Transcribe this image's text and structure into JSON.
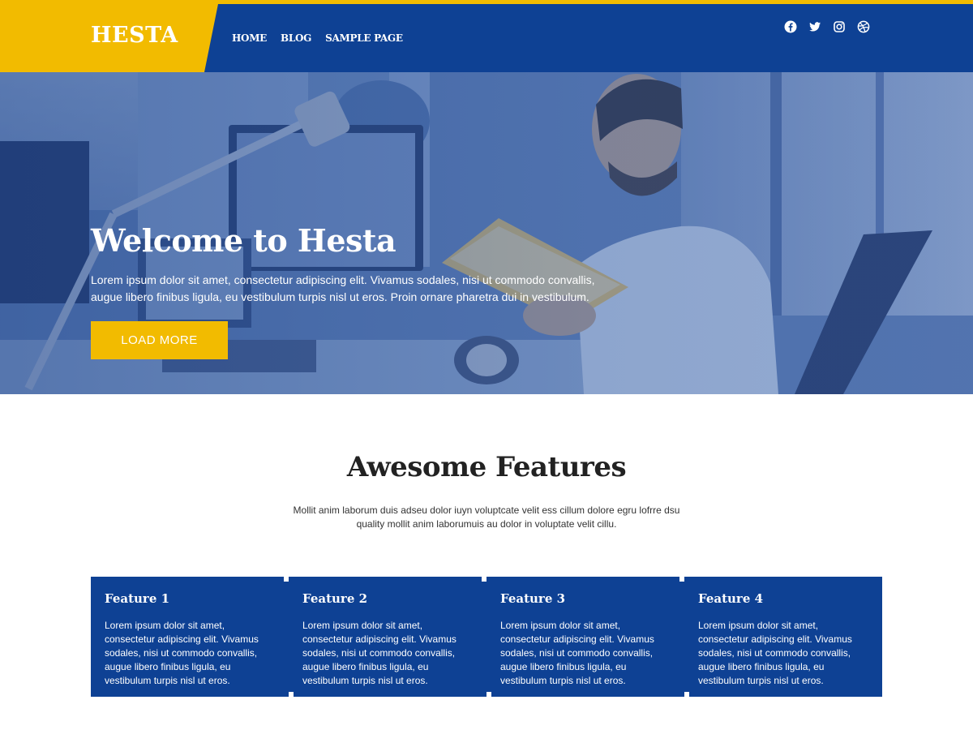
{
  "header": {
    "logo": "HESTA",
    "nav": [
      "HOME",
      "BLOG",
      "SAMPLE PAGE"
    ],
    "social_icons": [
      "facebook-icon",
      "twitter-icon",
      "instagram-icon",
      "dribbble-icon"
    ],
    "colors": {
      "primary": "#0e4194",
      "accent": "#f2bb00"
    }
  },
  "hero": {
    "title": "Welcome to Hesta",
    "text": "Lorem ipsum dolor sit amet, consectetur adipiscing elit. Vivamus sodales, nisi ut commodo convallis, augue libero finibus ligula, eu vestibulum turpis nisl ut eros. Proin ornare pharetra dui in vestibulum.",
    "button": "LOAD MORE"
  },
  "features": {
    "title": "Awesome Features",
    "subtitle": "Mollit anim laborum duis adseu dolor iuyn voluptcate velit ess cillum dolore egru lofrre dsu quality mollit anim laborumuis au dolor in voluptate velit cillu.",
    "items": [
      {
        "title": "Feature 1",
        "text": "Lorem ipsum dolor sit amet, consectetur adipiscing elit. Vivamus sodales, nisi ut commodo convallis, augue libero finibus ligula, eu vestibulum turpis nisl ut eros."
      },
      {
        "title": "Feature 2",
        "text": "Lorem ipsum dolor sit amet, consectetur adipiscing elit. Vivamus sodales, nisi ut commodo convallis, augue libero finibus ligula, eu vestibulum turpis nisl ut eros."
      },
      {
        "title": "Feature 3",
        "text": "Lorem ipsum dolor sit amet, consectetur adipiscing elit. Vivamus sodales, nisi ut commodo convallis, augue libero finibus ligula, eu vestibulum turpis nisl ut eros."
      },
      {
        "title": "Feature 4",
        "text": "Lorem ipsum dolor sit amet, consectetur adipiscing elit. Vivamus sodales, nisi ut commodo convallis, augue libero finibus ligula, eu vestibulum turpis nisl ut eros."
      }
    ]
  }
}
